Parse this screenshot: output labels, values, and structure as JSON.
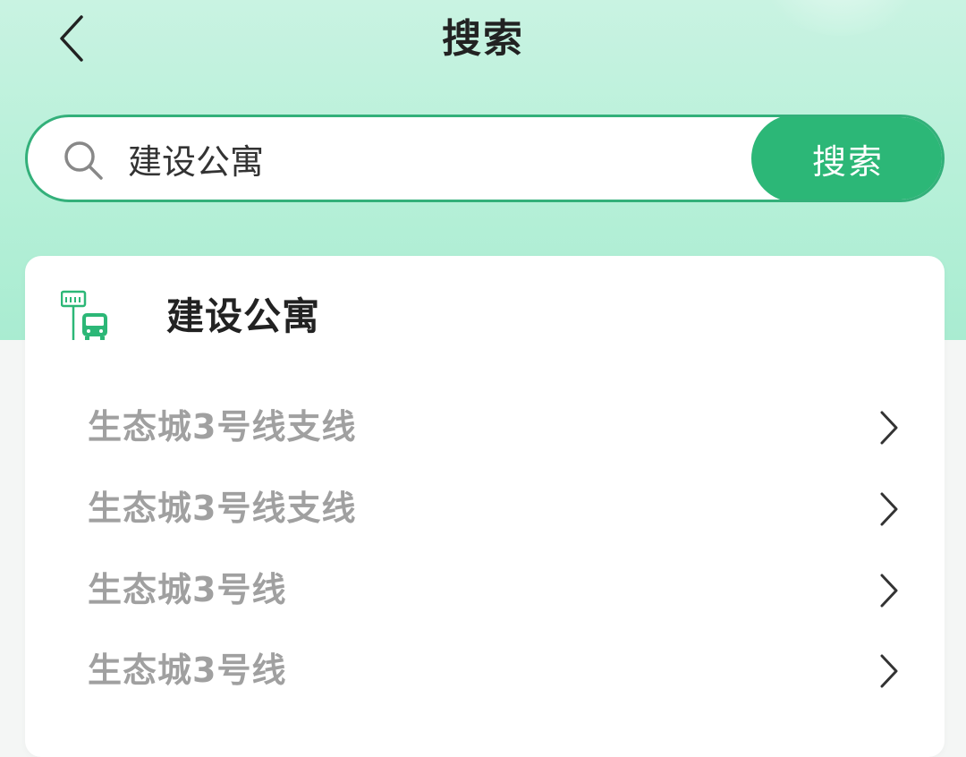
{
  "header": {
    "title": "搜索",
    "back_icon": "chevron-left-icon"
  },
  "search": {
    "value": "建设公寓",
    "icon": "search-icon",
    "button_label": "搜索"
  },
  "result": {
    "stop_icon": "bus-stop-icon",
    "stop_name": "建设公寓",
    "routes": [
      {
        "label": "生态城3号线支线"
      },
      {
        "label": "生态城3号线支线"
      },
      {
        "label": "生态城3号线"
      },
      {
        "label": "生态城3号线"
      }
    ],
    "route_icon": "chevron-right-icon"
  },
  "colors": {
    "accent": "#2cb777",
    "header_bg": "#b6f0d8",
    "route_text": "#a0a0a0"
  }
}
